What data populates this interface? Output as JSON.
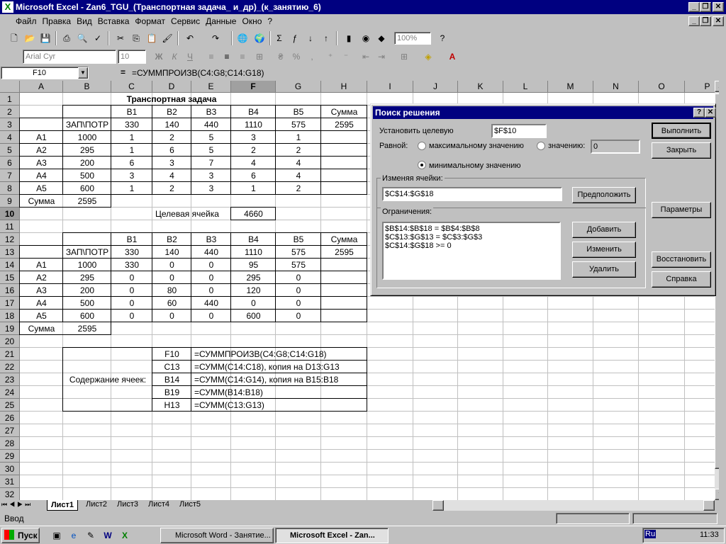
{
  "window": {
    "title": "Microsoft Excel - Zan6_TGU_(Транспортная задача_ и_др)_(к_занятию_6)"
  },
  "menu": [
    "Файл",
    "Правка",
    "Вид",
    "Вставка",
    "Формат",
    "Сервис",
    "Данные",
    "Окно",
    "?"
  ],
  "format_toolbar": {
    "font": "Arial Cyr",
    "size": "10",
    "zoom": "100%"
  },
  "formula_bar": {
    "name_box": "F10",
    "eq": "=",
    "formula": "=СУММПРОИЗВ(C4:G8;C14:G18)"
  },
  "columns": [
    "A",
    "B",
    "C",
    "D",
    "E",
    "F",
    "G",
    "H",
    "I",
    "J",
    "K",
    "L",
    "M",
    "N",
    "O",
    "P"
  ],
  "rows": [
    "1",
    "2",
    "3",
    "4",
    "5",
    "6",
    "7",
    "8",
    "9",
    "10",
    "11",
    "12",
    "13",
    "14",
    "15",
    "16",
    "17",
    "18",
    "19",
    "20",
    "21",
    "22",
    "23",
    "24",
    "25",
    "26",
    "27",
    "28",
    "29",
    "30",
    "31",
    "32",
    "33"
  ],
  "sheet": {
    "title": "Транспортная задача",
    "top_header": [
      "B1",
      "B2",
      "B3",
      "B4",
      "B5",
      "Сумма"
    ],
    "top_demand": {
      "label": "ЗАП\\ПОТР",
      "values": [
        "330",
        "140",
        "440",
        "1110",
        "575",
        "2595"
      ]
    },
    "top_rows": [
      {
        "name": "A1",
        "supply": "1000",
        "vals": [
          "1",
          "2",
          "5",
          "3",
          "1"
        ]
      },
      {
        "name": "A2",
        "supply": "295",
        "vals": [
          "1",
          "6",
          "5",
          "2",
          "2"
        ]
      },
      {
        "name": "A3",
        "supply": "200",
        "vals": [
          "6",
          "3",
          "7",
          "4",
          "4"
        ]
      },
      {
        "name": "A4",
        "supply": "500",
        "vals": [
          "3",
          "4",
          "3",
          "6",
          "4"
        ]
      },
      {
        "name": "A5",
        "supply": "600",
        "vals": [
          "1",
          "2",
          "3",
          "1",
          "2"
        ]
      }
    ],
    "sum_label": "Сумма",
    "sum_value": "2595",
    "target_label": "Целевая ячейка",
    "target_value": "4660",
    "bottom_header": [
      "B1",
      "B2",
      "B3",
      "B4",
      "B5",
      "Сумма"
    ],
    "bottom_demand": {
      "label": "ЗАП\\ПОТР",
      "values": [
        "330",
        "140",
        "440",
        "1110",
        "575",
        "2595"
      ]
    },
    "bottom_rows": [
      {
        "name": "A1",
        "supply": "1000",
        "vals": [
          "330",
          "0",
          "0",
          "95",
          "575"
        ]
      },
      {
        "name": "A2",
        "supply": "295",
        "vals": [
          "0",
          "0",
          "0",
          "295",
          "0"
        ]
      },
      {
        "name": "A3",
        "supply": "200",
        "vals": [
          "0",
          "80",
          "0",
          "120",
          "0"
        ]
      },
      {
        "name": "A4",
        "supply": "500",
        "vals": [
          "0",
          "60",
          "440",
          "0",
          "0"
        ]
      },
      {
        "name": "A5",
        "supply": "600",
        "vals": [
          "0",
          "0",
          "0",
          "600",
          "0"
        ]
      }
    ],
    "sum2_label": "Сумма",
    "sum2_value": "2595",
    "contents_label": "Содержание ячеек:",
    "contents": [
      {
        "cell": "F10",
        "formula": "=СУММПРОИЗВ(C4:G8;C14:G18)"
      },
      {
        "cell": "C13",
        "formula": "=СУММ(C14:C18), копия на D13:G13"
      },
      {
        "cell": "B14",
        "formula": "=СУММ(C14:G14), копия на B15:B18"
      },
      {
        "cell": "B19",
        "formula": "=СУММ(B14:B18)"
      },
      {
        "cell": "H13",
        "formula": "=СУММ(C13:G13)"
      }
    ]
  },
  "dialog": {
    "title": "Поиск решения",
    "target_label": "Установить целевую",
    "target_value": "$F$10",
    "equal_label": "Равной:",
    "opt_max": "максимальному значению",
    "opt_value": "значению:",
    "value_field": "0",
    "opt_min": "минимальному значению",
    "changing_label": "Изменяя ячейки:",
    "changing_value": "$C$14:$G$18",
    "guess_btn": "Предположить",
    "constraints_label": "Ограничения:",
    "constraints": [
      "$B$14:$B$18 = $B$4:$B$8",
      "$C$13:$G$13 = $C$3:$G$3",
      "$C$14:$G$18 >= 0"
    ],
    "add_btn": "Добавить",
    "change_btn": "Изменить",
    "delete_btn": "Удалить",
    "run_btn": "Выполнить",
    "close_btn": "Закрыть",
    "params_btn": "Параметры",
    "restore_btn": "Восстановить",
    "help_btn": "Справка"
  },
  "sheet_tabs": [
    "Лист1",
    "Лист2",
    "Лист3",
    "Лист4",
    "Лист5"
  ],
  "status": "Ввод",
  "taskbar": {
    "start": "Пуск",
    "task1": "Microsoft Word - Занятие...",
    "task2": "Microsoft Excel - Zan...",
    "lang": "Ru",
    "time": "11:33"
  }
}
